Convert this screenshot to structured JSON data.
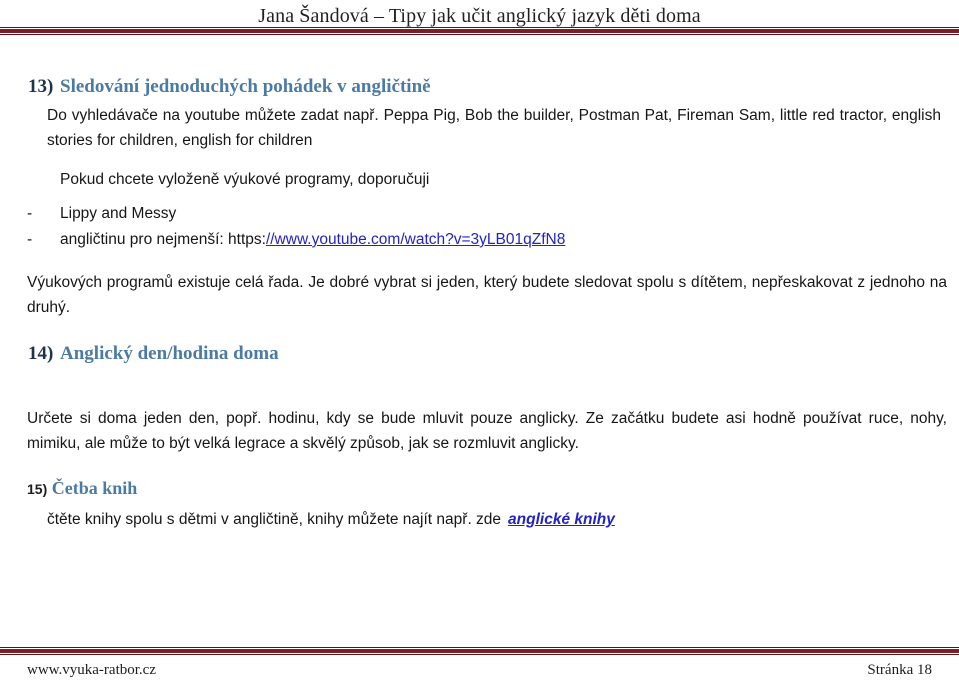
{
  "header": {
    "title": "Jana Šandová – Tipy jak učit anglický jazyk děti doma"
  },
  "colors": {
    "rule_dark": "#5e1118",
    "rule_maroon": "#7a1f27",
    "heading_blue": "#4b7aa3",
    "heading_number": "#1f3348",
    "link_blue": "#2222cc",
    "body_text": "#161616",
    "page_background": "#ffffff"
  },
  "sections": [
    {
      "number": "13)",
      "title": "Sledování jednoduchých pohádek v angličtině",
      "intro": "Do vyhledávače na youtube můžete zadat např. Peppa Pig, Bob the builder, Postman Pat, Fireman Sam, little red tractor, english stories for children, english for children",
      "lead_in": "Pokud chcete vyloženě výukové programy, doporučuji",
      "bullet_marker": "-",
      "bullets": [
        {
          "text": "Lippy and Messy",
          "link_prefix": "",
          "link_text": ""
        },
        {
          "text": "angličtinu pro nejmenší: https:",
          "link_prefix": "https:",
          "link_text": "//www.youtube.com/watch?v=3yLB01qZfN8"
        }
      ],
      "bullet_two_label": "angličtinu pro nejmenší: ",
      "bullet_two_scheme": "https:",
      "bullet_two_url": "//www.youtube.com/watch?v=3yLB01qZfN8",
      "closing": "Výukových programů existuje celá řada. Je dobré vybrat si jeden, který budete sledovat spolu s dítětem, nepřeskakovat z jednoho na druhý."
    },
    {
      "number": "14)",
      "title": "Anglický den/hodina doma",
      "body": "Určete si doma jeden den, popř. hodinu, kdy se bude mluvit pouze anglicky. Ze začátku budete asi hodně používat ruce, nohy, mimiku, ale může to být velká legrace a skvělý způsob, jak se rozmluvit anglicky."
    },
    {
      "number": "15)",
      "title": "Četba knih",
      "body": "čtěte knihy spolu s dětmi v angličtině, knihy můžete najít např. zde",
      "link_text": "anglické knihy"
    }
  ],
  "footer": {
    "site": "www.vyuka-ratbor.cz",
    "page_label": "Stránka 18"
  }
}
